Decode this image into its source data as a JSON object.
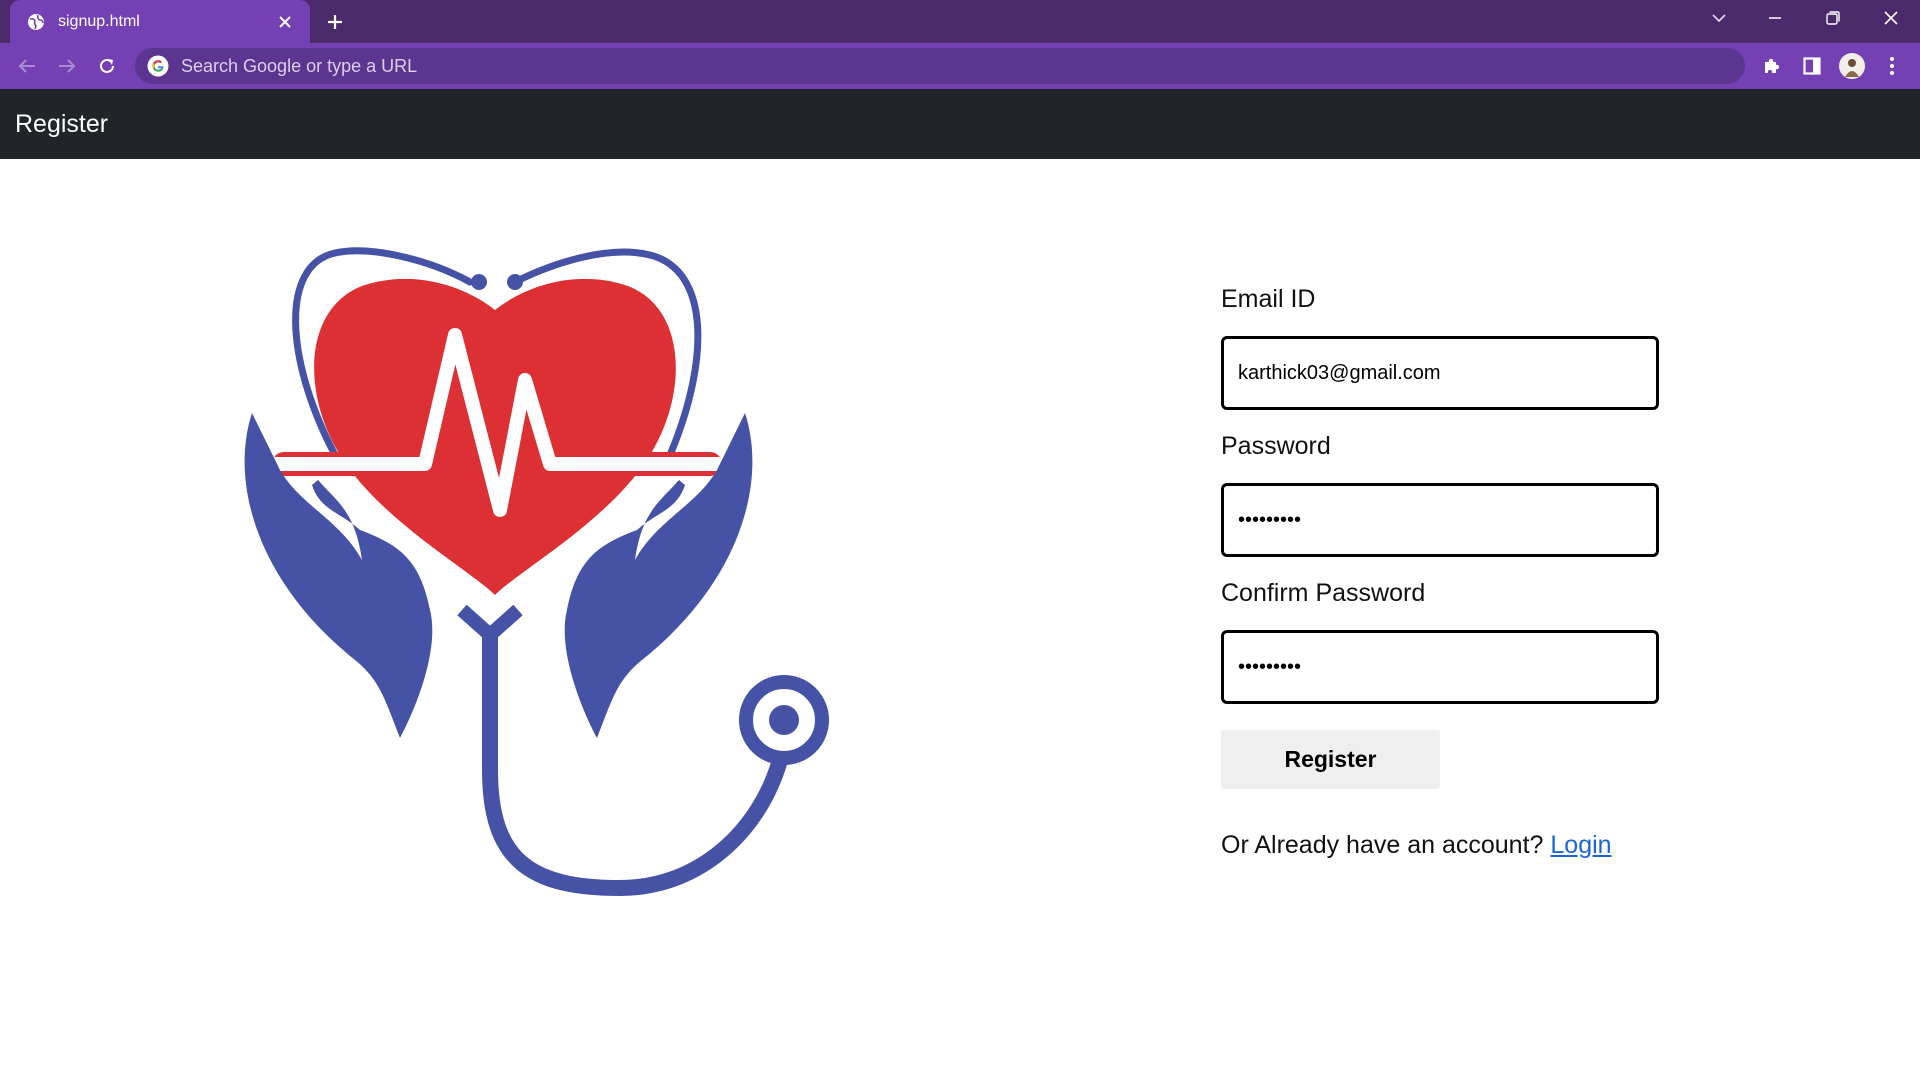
{
  "browser": {
    "tab_title": "signup.html",
    "omnibox_placeholder": "Search Google or type a URL"
  },
  "navbar": {
    "brand": "Register"
  },
  "form": {
    "email_label": "Email ID",
    "email_value": "karthick03@gmail.com",
    "password_label": "Password",
    "password_value": "secret123",
    "confirm_label": "Confirm Password",
    "confirm_value": "secret123",
    "submit_label": "Register",
    "login_prompt": "Or Already have an account?",
    "login_link": "Login"
  },
  "colors": {
    "tabstrip": "#4a2a6b",
    "toolbar": "#7440b3",
    "appbar": "#212529",
    "heart": "#dc3035",
    "logo_blue": "#4652a6",
    "link": "#1a66d9"
  },
  "icons": [
    "globe-icon",
    "close-icon",
    "plus-icon",
    "chevron-down-icon",
    "minimize-icon",
    "restore-icon",
    "back-icon",
    "forward-icon",
    "reload-icon",
    "google-icon",
    "puzzle-icon",
    "sidepanel-icon",
    "avatar",
    "kebab-menu-icon"
  ]
}
